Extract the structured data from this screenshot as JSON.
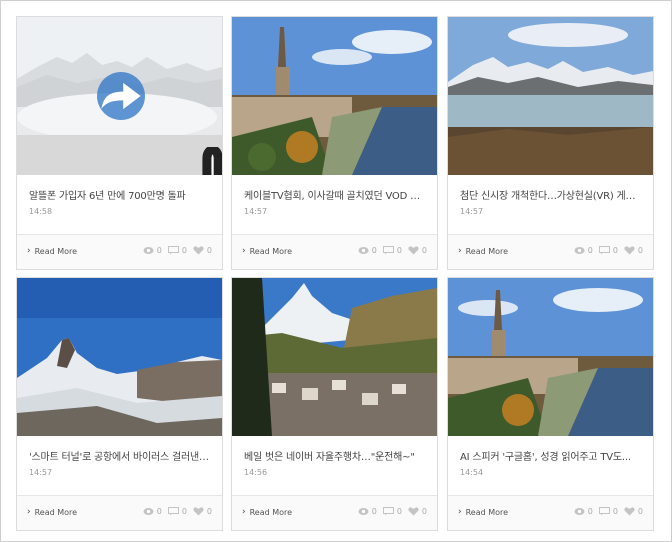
{
  "cards": [
    {
      "title": "알뜰폰 가입자 6년 만에 700만명 돌파",
      "time": "14:58",
      "read_more": "Read More",
      "views": "0",
      "comments": "0",
      "likes": "0"
    },
    {
      "title": "케이블TV협회, 이사갈때 골치였던 VOD 승계...",
      "time": "14:57",
      "read_more": "Read More",
      "views": "0",
      "comments": "0",
      "likes": "0"
    },
    {
      "title": "첨단 신시장 개척한다…가상현실(VR) 게임 등...",
      "time": "14:57",
      "read_more": "Read More",
      "views": "0",
      "comments": "0",
      "likes": "0"
    },
    {
      "title": "'스마트 터널'로 공항에서 바이러스 걸러낸다면...",
      "time": "14:57",
      "read_more": "Read More",
      "views": "0",
      "comments": "0",
      "likes": "0"
    },
    {
      "title": "베일 벗은 네이버 자율주행차…\"운전해~\"",
      "time": "14:56",
      "read_more": "Read More",
      "views": "0",
      "comments": "0",
      "likes": "0"
    },
    {
      "title": "AI 스피커 '구글홈', 성경 읽어주고 TV도...",
      "time": "14:54",
      "read_more": "Read More",
      "views": "0",
      "comments": "0",
      "likes": "0"
    }
  ],
  "colors": {
    "overlay_accent": "#3478c8",
    "text_title": "#444444",
    "text_muted": "#9a9a9a"
  },
  "icons": {
    "overlay": "share-arrow-icon",
    "readmore": "chevron-right-icon",
    "views": "eye-icon",
    "comments": "comment-icon",
    "likes": "heart-icon"
  }
}
